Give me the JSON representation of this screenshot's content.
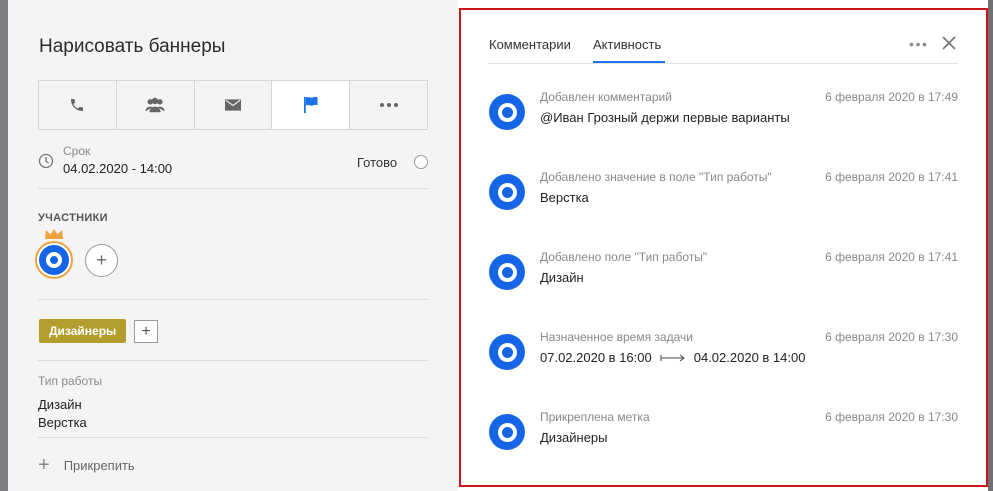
{
  "task": {
    "title": "Нарисовать баннеры"
  },
  "action_bar": {
    "buttons": [
      {
        "icon": "phone-icon"
      },
      {
        "icon": "users-icon"
      },
      {
        "icon": "mail-icon"
      },
      {
        "icon": "flag-icon"
      },
      {
        "icon": "more-icon"
      }
    ],
    "active_index": 3
  },
  "deadline": {
    "label": "Срок",
    "value": "04.02.2020 - 14:00",
    "done_label": "Готово"
  },
  "participants": {
    "heading": "УЧАСТНИКИ",
    "add_symbol": "+"
  },
  "tags": {
    "items": [
      "Дизайнеры"
    ],
    "add_symbol": "+"
  },
  "work_type": {
    "label": "Тип работы",
    "values": [
      "Дизайн",
      "Верстка"
    ]
  },
  "attach": {
    "plus": "+",
    "label": "Прикрепить"
  },
  "side_panel": {
    "tabs": [
      {
        "label": "Комментарии"
      },
      {
        "label": "Активность"
      }
    ],
    "active_tab": 1,
    "feed": [
      {
        "action": "Добавлен комментарий",
        "time": "6 февраля 2020 в 17:49",
        "detail": "@Иван Грозный держи первые варианты"
      },
      {
        "action": "Добавлено значение в поле \"Тип работы\"",
        "time": "6 февраля 2020 в 17:41",
        "detail": "Верстка"
      },
      {
        "action": "Добавлено поле \"Тип работы\"",
        "time": "6 февраля 2020 в 17:41",
        "detail": "Дизайн"
      },
      {
        "action": "Назначенное время задачи",
        "time": "6 февраля 2020 в 17:30",
        "from": "07.02.2020 в 16:00",
        "to": "04.02.2020 в 14:00"
      },
      {
        "action": "Прикреплена метка",
        "time": "6 февраля 2020 в 17:30",
        "detail": "Дизайнеры"
      }
    ]
  },
  "colors": {
    "accent_blue": "#1565e6",
    "tab_underline": "#1a73e8",
    "tag_gold": "#b39d2c",
    "crown_orange": "#f0a33c",
    "highlight_red": "#c8181c"
  }
}
